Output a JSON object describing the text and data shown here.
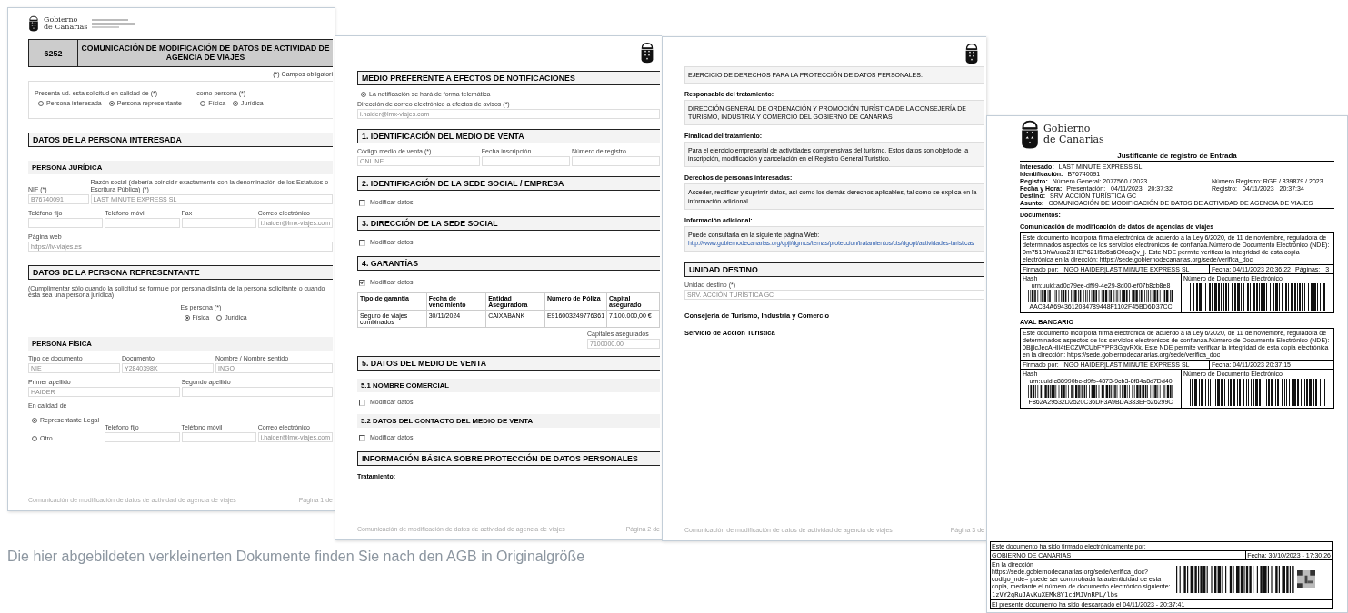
{
  "pages": [
    {
      "blocks": [
        {
          "kind": "logo",
          "lines": [
            "Gobierno",
            "de Canarias"
          ]
        },
        {
          "kind": "title",
          "code": "6252",
          "text": "COMUNICACIÓN DE MODIFICACIÓN DE DATOS DE ACTIVIDAD DE AGENCIA DE VIAJES"
        },
        {
          "kind": "required_note",
          "text": "(*) Campos obligatori"
        },
        {
          "kind": "radio_panel",
          "groups": [
            {
              "label": "Presenta ud. esta solicitud en calidad de (*)",
              "options": [
                {
                  "label": "Persona interesada",
                  "selected": false
                },
                {
                  "label": "Persona representante",
                  "selected": true
                }
              ]
            },
            {
              "label": "como persona (*)",
              "options": [
                {
                  "label": "Física",
                  "selected": false
                },
                {
                  "label": "Jurídica",
                  "selected": true
                }
              ]
            }
          ]
        },
        {
          "kind": "section",
          "text": "DATOS DE LA PERSONA INTERESADA"
        },
        {
          "kind": "subsection",
          "text": "PERSONA JURÍDICA"
        },
        {
          "kind": "fields",
          "items": [
            {
              "label": "NIF (*)",
              "value": "B76740091"
            },
            {
              "label": "Razón social (debería coincidir exactamente con la denominación de los Estatutos o Escritura Pública) (*)",
              "value": "LAST MINUTE EXPRESS SL"
            }
          ]
        },
        {
          "kind": "fields",
          "items": [
            {
              "label": "Teléfono fijo"
            },
            {
              "label": "Teléfono móvil"
            },
            {
              "label": "Fax"
            },
            {
              "label": "Correo electrónico",
              "value": "i.haider@lmx-viajes.com"
            }
          ]
        },
        {
          "kind": "fields",
          "items": [
            {
              "label": "Página web",
              "value": "https://lv-viajes.es"
            }
          ]
        },
        {
          "kind": "section",
          "text": "DATOS DE LA PERSONA REPRESENTANTE"
        },
        {
          "kind": "note",
          "text": "(Cumplimentar sólo cuando la solicitud se formule por persona distinta de la persona solicitante o cuando ésta sea una persona jurídica)"
        },
        {
          "kind": "radios",
          "groups": [
            {
              "label": "Es persona (*)",
              "options": [
                {
                  "label": "Física",
                  "selected": true
                },
                {
                  "label": "Jurídica",
                  "selected": false
                }
              ]
            }
          ]
        },
        {
          "kind": "subsection",
          "text": "PERSONA FÍSICA"
        },
        {
          "kind": "fields",
          "items": [
            {
              "label": "Tipo de documento",
              "value": "NIE"
            },
            {
              "label": "Documento",
              "value": "Y2840398K"
            },
            {
              "label": "Nombre / Nombre sentido",
              "value": "INGO"
            }
          ]
        },
        {
          "kind": "fields",
          "items": [
            {
              "label": "Primer apellido",
              "value": "HAIDER"
            },
            {
              "label": "Segundo apellido"
            }
          ]
        },
        {
          "kind": "fields",
          "items": [
            {
              "label": "En calidad de",
              "options": [
                {
                  "label": "Representante Legal",
                  "selected": true
                },
                {
                  "label": "Otro",
                  "selected": false
                }
              ]
            },
            {
              "label": "Teléfono fijo"
            },
            {
              "label": "Teléfono móvil"
            },
            {
              "label": "Correo electrónico",
              "value": "i.haider@lmx-viajes.com"
            }
          ]
        }
      ],
      "footer": {
        "text": "Comunicación de modificación de datos de actividad de agencia de viajes",
        "page": "Página 1 de"
      }
    },
    {
      "blocks": [
        {
          "kind": "crest"
        },
        {
          "kind": "section",
          "text": "MEDIO PREFERENTE A EFECTOS DE NOTIFICACIONES"
        },
        {
          "kind": "radios",
          "groups": [
            {
              "options": [
                {
                  "label": "La notificación se hará de forma telemática",
                  "selected": true
                }
              ]
            }
          ]
        },
        {
          "kind": "fields",
          "items": [
            {
              "label": "Dirección de correo electrónico a efectos de avisos (*)",
              "value": "i.haider@lmx-viajes.com"
            }
          ]
        },
        {
          "kind": "section",
          "text": "1. IDENTIFICACIÓN DEL MEDIO DE VENTA"
        },
        {
          "kind": "fields",
          "items": [
            {
              "label": "Código medio de venta (*)",
              "value": "ONLINE"
            },
            {
              "label": "Fecha inscripción"
            },
            {
              "label": "Número de registro"
            }
          ]
        },
        {
          "kind": "section",
          "text": "2. IDENTIFICACIÓN DE LA SEDE SOCIAL / EMPRESA"
        },
        {
          "kind": "checkbox",
          "label": "Modificar datos",
          "checked": false
        },
        {
          "kind": "section",
          "text": "3. DIRECCIÓN DE LA SEDE SOCIAL"
        },
        {
          "kind": "checkbox",
          "label": "Modificar datos",
          "checked": false
        },
        {
          "kind": "section",
          "text": "4. GARANTÍAS"
        },
        {
          "kind": "checkbox",
          "label": "Modificar datos",
          "checked": true
        },
        {
          "kind": "table",
          "columns": [
            "Tipo de garantía",
            "Fecha de vencimiento",
            "Entidad Aseguradora",
            "Número de Póliza",
            "Capital asegurado"
          ],
          "rows": [
            [
              "Seguro de viajes combinados",
              "30/11/2024",
              "CAIXABANK",
              "E916003249776361",
              "7.100.000,00 €"
            ]
          ]
        },
        {
          "kind": "total",
          "label": "Capitales asegurados",
          "value": "7100000.00"
        },
        {
          "kind": "section",
          "text": "5. DATOS DEL MEDIO DE VENTA"
        },
        {
          "kind": "subsection",
          "text": "5.1 NOMBRE COMERCIAL"
        },
        {
          "kind": "checkbox",
          "label": "Modificar datos",
          "checked": false
        },
        {
          "kind": "subsection",
          "text": "5.2 DATOS DEL CONTACTO DEL MEDIO DE VENTA"
        },
        {
          "kind": "checkbox",
          "label": "Modificar datos",
          "checked": false
        },
        {
          "kind": "section",
          "text": "INFORMACIÓN BÁSICA SOBRE PROTECCIÓN DE DATOS PERSONALES"
        },
        {
          "kind": "label",
          "text": "Tratamiento:"
        }
      ],
      "footer": {
        "text": "Comunicación de modificación de datos de actividad de agencia de viajes",
        "page": "Página 2 de"
      }
    },
    {
      "blocks": [
        {
          "kind": "crest"
        },
        {
          "kind": "info",
          "text": "EJERCICIO DE DERECHOS PARA LA PROTECCIÓN DE DATOS PERSONALES."
        },
        {
          "kind": "info",
          "label": "Responsable del tratamiento:",
          "text": "DIRECCIÓN GENERAL DE ORDENACIÓN Y PROMOCIÓN TURÍSTICA DE LA CONSEJERÍA DE TURISMO, INDUSTRIA Y COMERCIO DEL GOBIERNO DE CANARIAS"
        },
        {
          "kind": "info",
          "label": "Finalidad del tratamiento:",
          "text": "Para el ejercicio empresarial de actividades comprensivas del turismo. Estos datos son objeto de la inscripción, modificación y cancelación en el Registro General Turístico."
        },
        {
          "kind": "info",
          "label": "Derechos de personas interesadas:",
          "text": "Acceder, rectificar y suprimir datos, así como los demás derechos aplicables, tal como se explica en la información adicional."
        },
        {
          "kind": "info",
          "label": "Información adicional:",
          "text": "Puede consultarla en la siguiente página Web:",
          "link": "http://www.gobiernodecanarias.org/cpji/dgmcs/temas/proteccion/tratamientos/cts/dgopt/actividades-turisticas"
        },
        {
          "kind": "section",
          "text": "UNIDAD DESTINO"
        },
        {
          "kind": "fields",
          "items": [
            {
              "label": "Unidad destino (*)",
              "value": "SRV. ACCIÓN TURÍSTICA GC"
            }
          ]
        },
        {
          "kind": "signature",
          "text": "Consejería de Turismo, Industria y Comercio"
        },
        {
          "kind": "signature",
          "text": "Servicio de Acción Turística"
        }
      ],
      "footer": {
        "text": "Comunicación de modificación de datos de actividad de agencia de viajes",
        "page": "Página 3 de"
      }
    }
  ],
  "receipt": {
    "logo": [
      "Gobierno",
      "de Canarias"
    ],
    "title": "Justificante de registro de Entrada",
    "rows": [
      {
        "label": "Interesado:",
        "value": [
          "LAST MINUTE EXPRESS SL"
        ]
      },
      {
        "label": "Identificación:",
        "value": [
          "B76740091"
        ]
      },
      {
        "label": "Registro:",
        "value": [
          "Número General: 2077560 / 2023"
        ],
        "extra": [
          "Número Registro: RGE / 839879 / 2023"
        ]
      },
      {
        "label": "Fecha y Hora:",
        "value": [
          "Presentación:",
          "04/11/2023",
          "20:37:32"
        ],
        "extra": [
          "Registro:",
          "04/11/2023",
          "20:37:34"
        ]
      },
      {
        "label": "Destino:",
        "value": [
          "SRV. ACCIÓN TURÍSTICA GC"
        ]
      },
      {
        "label": "Asunto:",
        "value": [
          "COMUNICACIÓN DE MODIFICACIÓN DE DATOS DE ACTIVIDAD DE AGENCIA DE VIAJES"
        ]
      }
    ],
    "documents_label": "Documentos:",
    "documents": [
      {
        "title": "Comunicación de modificación de datos de agencias de viajes",
        "text": "Este documento incorpora firma electrónica de acuerdo a la Ley 6/2020, de 11 de noviembre, reguladora de determinados aspectos de los servicios electrónicos de confianza.Número de Documento Electrónico (NDE): 0m751DhWuoa21HEP621I5o5s6O0caQv_j. Este NDE permite verificar la integridad de esta copia electrónica en la dirección: https://sede.gobiernodecanarias.org/sede/verifica_doc",
        "signed_label": "Firmado por:",
        "signer": "INGO HAIDER|LAST MINUTE EXPRESS SL",
        "date": "Fecha:  04/11/2023 20:36:22",
        "pages_label": "Páginas:",
        "pages": "3",
        "hash_label": "Hash",
        "uuid": "urn:uuid:ad0c79ee-df99-4e29-8d00-ef07b8cb8e8",
        "hash": "AAC34A6943612034789448F1102F45BD6D37CC",
        "nde_label": "Número de Documento Electrónico"
      },
      {
        "title": "AVAL BANCARIO",
        "text": "Este documento incorpora firma electrónica de acuerdo a la Ley 6/2020, de 11 de noviembre, reguladora de determinados aspectos de los servicios electrónicos de confianza.Número de Documento Electrónico (NDE): 0BjjIcJecAHII4tECZWCUbFYPR3GgvRXk. Este NDE permite verificar la integridad de esta copia electrónica en la dirección: https://sede.gobiernodecanarias.org/sede/verifica_doc",
        "signed_label": "Firmado por:",
        "signer": "INGO HAIDER|LAST MINUTE EXPRESS SL",
        "date": "Fecha:  04/11/2023 20:37:15",
        "hash_label": "Hash",
        "uuid": "urn:uuid:c88990bc-d9fb-4873-9cb3-8f84a8d7Dd40",
        "hash": "F862A29532D2520C36DF3A9BDA383EF526299C",
        "nde_label": "Número de Documento Electrónico"
      }
    ],
    "stamp": {
      "signed_by_label": "Este documento ha sido firmado electrónicamente por:",
      "signer": "GOBIERNO DE CANARIAS",
      "date": "Fecha: 30/10/2023 - 17:30:26",
      "verify_text": "En la dirección https://sede.gobiernodecanarias.org/sede/verifica_doc?codigo_nde= puede ser comprobada la autenticidad de esta copia, mediante el número de documento electrónico siguiente:",
      "code": "1zVY2gRuJAvKuXEMk8Y1cdMJVnRPL/lbs",
      "downloaded": "El presente documento ha sido descargado el 04/11/2023 - 20:37:41"
    }
  },
  "caption": "Die hier abgebildeten verkleinerten Dokumente finden Sie nach den AGB in Originalgröße"
}
